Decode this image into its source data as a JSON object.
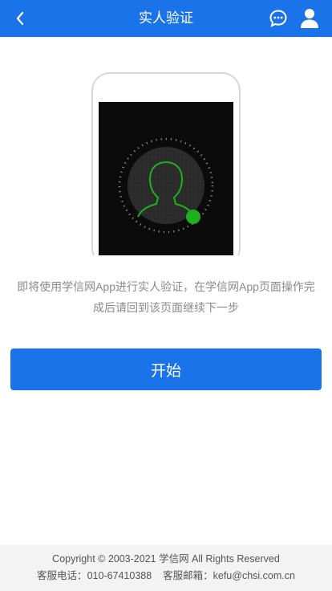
{
  "header": {
    "title": "实人验证",
    "back_icon": "chevron-left-icon",
    "chat_icon": "chat-bubble-icon",
    "user_icon": "user-icon"
  },
  "main": {
    "description": "即将使用学信网App进行实人验证，在学信网App页面操作完成后请回到该页面继续下一步",
    "start_button": "开始"
  },
  "footer": {
    "copyright": "Copyright © 2003-2021 学信网 All Rights Reserved",
    "phone_label": "客服电话：",
    "phone": "010-67410388",
    "email_label": "客服邮箱：",
    "email": "kefu@chsi.com.cn"
  },
  "colors": {
    "primary": "#1a73e8",
    "face_outline": "#1fb01f",
    "footer_bg": "#f3f3f3"
  }
}
